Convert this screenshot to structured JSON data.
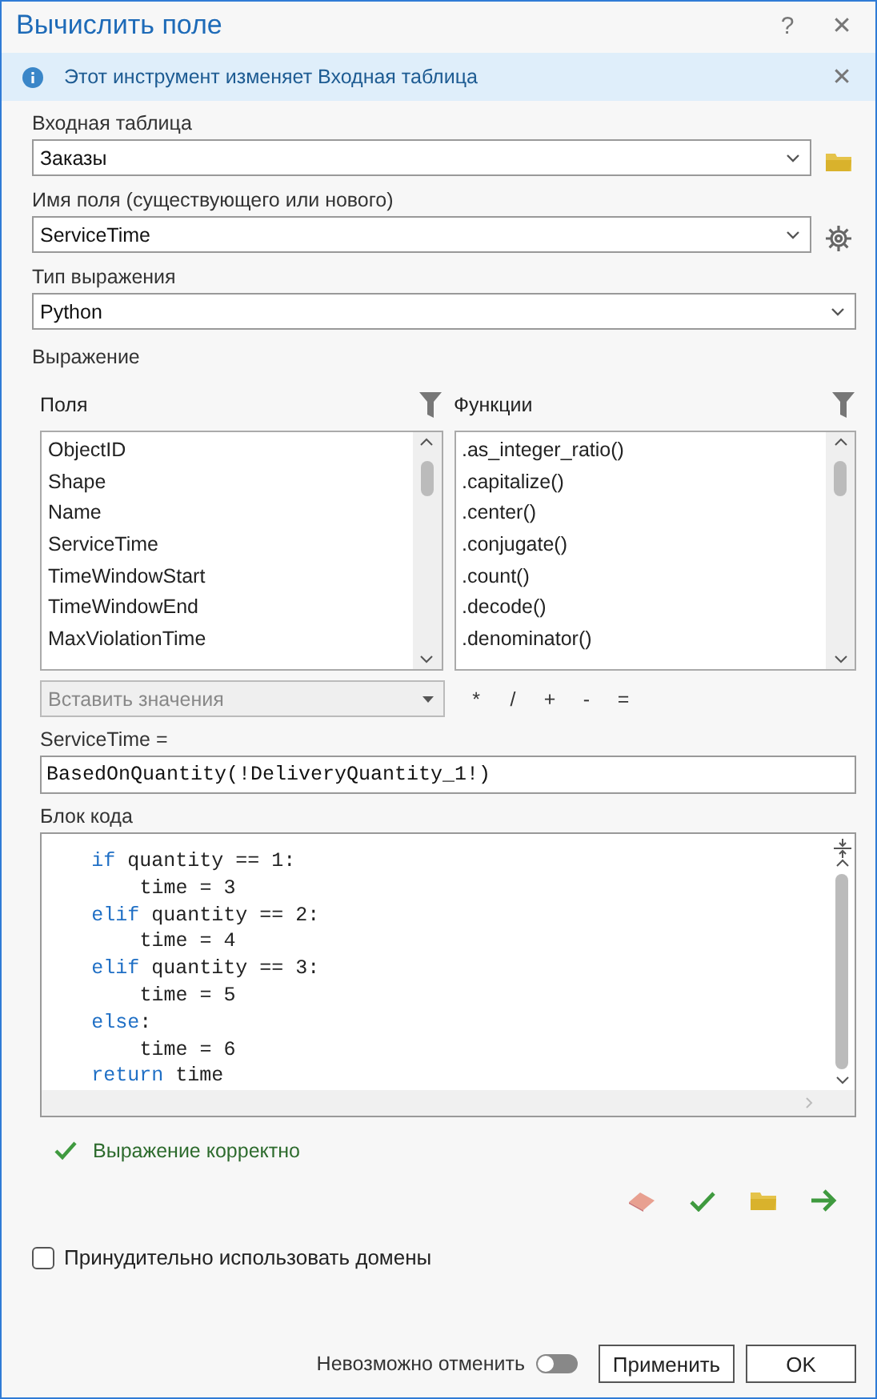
{
  "window": {
    "title": "Вычислить поле",
    "help": "?",
    "close": "✕"
  },
  "info_bar": {
    "message": "Этот инструмент изменяет Входная таблица",
    "close": "✕"
  },
  "input_table": {
    "label": "Входная таблица",
    "value": "Заказы"
  },
  "field_name": {
    "label": "Имя поля (существующего или нового)",
    "value": "ServiceTime"
  },
  "expression_type": {
    "label": "Тип выражения",
    "value": "Python"
  },
  "expression": {
    "label": "Выражение",
    "fields": {
      "title": "Поля",
      "items": [
        {
          "label": "ObjectID",
          "selected": false
        },
        {
          "label": "Shape",
          "selected": false
        },
        {
          "label": "Name",
          "selected": false
        },
        {
          "label": "ServiceTime",
          "selected": false
        },
        {
          "label": "TimeWindowStart",
          "selected": false
        },
        {
          "label": "TimeWindowEnd",
          "selected": false
        },
        {
          "label": "MaxViolationTime",
          "selected": false
        }
      ]
    },
    "functions": {
      "title": "Функции",
      "items": [
        {
          "label": ".as_integer_ratio()",
          "selected": false
        },
        {
          "label": ".capitalize()",
          "selected": false
        },
        {
          "label": ".center()",
          "selected": false
        },
        {
          "label": ".conjugate()",
          "selected": false
        },
        {
          "label": ".count()",
          "selected": false
        },
        {
          "label": ".decode()",
          "selected": false
        },
        {
          "label": ".denominator()",
          "selected": false
        }
      ]
    },
    "insert_values": {
      "placeholder": "Вставить значения",
      "disabled": true
    },
    "operators": [
      "*",
      "/",
      "+",
      "-",
      "="
    ],
    "target_label": "ServiceTime =",
    "value": "BasedOnQuantity(!DeliveryQuantity_1!)"
  },
  "code_block": {
    "label": "Блок кода",
    "lines": [
      {
        "parts": [
          {
            "kind": "keyword",
            "text": "if"
          },
          {
            "kind": "plain",
            "text": " quantity == 1:"
          }
        ],
        "children": [
          {
            "parts": [
              {
                "kind": "plain",
                "text": "time = 3"
              }
            ]
          }
        ]
      },
      {
        "parts": [
          {
            "kind": "keyword",
            "text": "elif"
          },
          {
            "kind": "plain",
            "text": " quantity == 2:"
          }
        ],
        "children": [
          {
            "parts": [
              {
                "kind": "plain",
                "text": "time = 4"
              }
            ]
          }
        ]
      },
      {
        "parts": [
          {
            "kind": "keyword",
            "text": "elif"
          },
          {
            "kind": "plain",
            "text": " quantity == 3:"
          }
        ],
        "children": [
          {
            "parts": [
              {
                "kind": "plain",
                "text": "time = 5"
              }
            ]
          }
        ]
      },
      {
        "parts": [
          {
            "kind": "keyword",
            "text": "else"
          },
          {
            "kind": "plain",
            "text": ":"
          }
        ],
        "children": [
          {
            "parts": [
              {
                "kind": "plain",
                "text": "time = 6"
              }
            ]
          }
        ]
      },
      {
        "parts": [
          {
            "kind": "keyword",
            "text": "return"
          },
          {
            "kind": "plain",
            "text": " time"
          }
        ]
      }
    ]
  },
  "validation": {
    "message": "Выражение корректно",
    "valid": true
  },
  "enforce_domains": {
    "label": "Принудительно использовать домены",
    "checked": false
  },
  "footer": {
    "undo_label": "Невозможно отменить",
    "undo_on": false,
    "buttons": [
      "Применить",
      "OK"
    ]
  }
}
